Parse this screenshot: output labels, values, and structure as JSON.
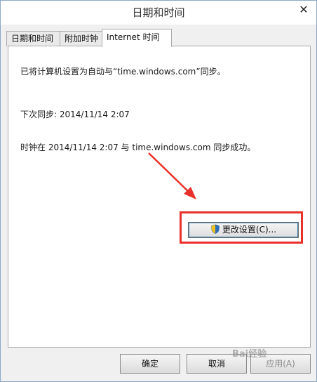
{
  "window": {
    "title": "日期和时间",
    "close_glyph": "✕"
  },
  "tabs": [
    {
      "label": "日期和时间"
    },
    {
      "label": "附加时钟"
    },
    {
      "label": "Internet 时间"
    }
  ],
  "panel": {
    "sync_status": "已将计算机设置为自动与“time.windows.com”同步。",
    "next_sync": "下次同步: 2014/11/14 2:07",
    "last_result": "时钟在 2014/11/14 2:07 与 time.windows.com 同步成功。",
    "change_button": "更改设置(C)..."
  },
  "footer": {
    "ok": "确定",
    "cancel": "取消",
    "apply": "应用(A)"
  },
  "watermark": "Bai经验",
  "colors": {
    "annotation": "#e8312a",
    "shield_blue": "#2f6fb6",
    "shield_yellow": "#f2c21b"
  },
  "icons": [
    "shield-icon",
    "close-icon"
  ]
}
